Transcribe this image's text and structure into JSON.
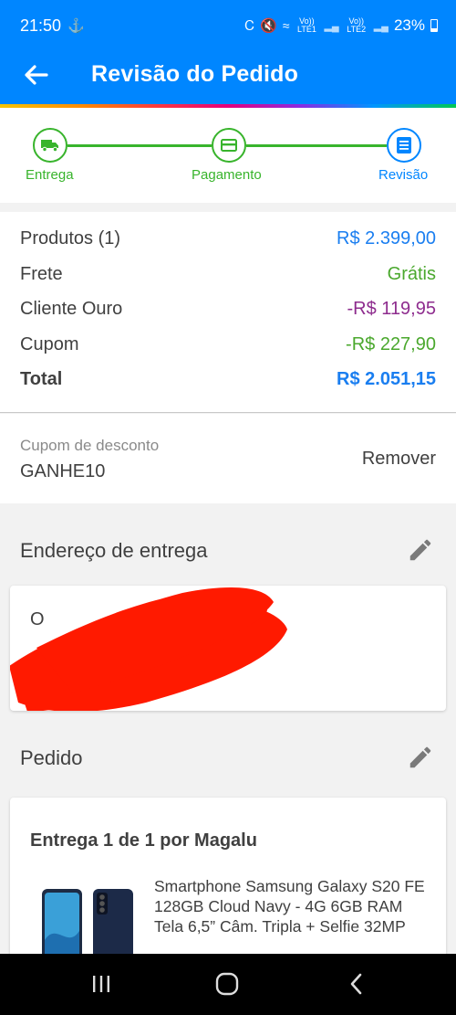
{
  "status_bar": {
    "time": "21:50",
    "network_1": "Vo)) LTE1",
    "network_2": "Vo)) LTE2",
    "battery": "23%"
  },
  "app_bar": {
    "title": "Revisão do Pedido",
    "back_icon": "arrow-left-icon"
  },
  "stepper": {
    "steps": [
      {
        "label": "Entrega",
        "icon": "truck-icon",
        "state": "done"
      },
      {
        "label": "Pagamento",
        "icon": "credit-card-icon",
        "state": "done"
      },
      {
        "label": "Revisão",
        "icon": "list-icon",
        "state": "active"
      }
    ],
    "colors": {
      "done": "#38b42c",
      "active": "#0086ff"
    }
  },
  "summary": {
    "rows": [
      {
        "label": "Produtos (1)",
        "value": "R$ 2.399,00"
      },
      {
        "label": "Frete",
        "value": "Grátis"
      },
      {
        "label": "Cliente Ouro",
        "value": "-R$ 119,95"
      },
      {
        "label": "Cupom",
        "value": "-R$ 227,90"
      },
      {
        "label": "Total",
        "value": "R$ 2.051,15"
      }
    ]
  },
  "coupon": {
    "label": "Cupom de desconto",
    "code": "GANHE10",
    "remove_label": "Remover"
  },
  "address_section": {
    "title": "Endereço de entrega",
    "visible_text": "O"
  },
  "order_section": {
    "title": "Pedido",
    "delivery": "Entrega 1 de 1 por Magalu",
    "product_name": "Smartphone Samsung Galaxy S20 FE 128GB Cloud Navy - 4G 6GB RAM Tela 6,5” Câm. Tripla + Selfie 32MP"
  },
  "colors": {
    "primary": "#0086ff",
    "success": "#4aa82d",
    "discount_purple": "#8e2c8e",
    "redaction": "#ff1a00"
  }
}
